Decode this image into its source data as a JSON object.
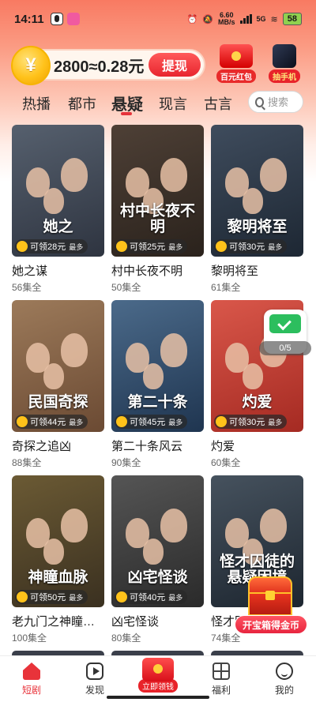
{
  "status_bar": {
    "time": "14:11",
    "net_speed_value": "6.60",
    "net_speed_unit": "MB/s",
    "network": "5G",
    "battery": "58"
  },
  "header": {
    "coin_balance": "2800≈0.28元",
    "coin_symbol": "¥",
    "withdraw_label": "提现",
    "promo_red_packet": "百元红包",
    "promo_phone": "抽手机"
  },
  "tabs": [
    {
      "label": "热播"
    },
    {
      "label": "都市"
    },
    {
      "label": "悬疑",
      "active": true
    },
    {
      "label": "现言"
    },
    {
      "label": "古言"
    }
  ],
  "search": {
    "placeholder": "搜索"
  },
  "dramas": [
    {
      "title": "她之谋",
      "episodes": "56集全",
      "reward": "可领28元",
      "poster_text": "她之",
      "colors": [
        "#2e3440",
        "#56606e"
      ]
    },
    {
      "title": "村中长夜不明",
      "episodes": "50集全",
      "reward": "可领25元",
      "poster_text": "村中长夜不明",
      "colors": [
        "#2a221c",
        "#4e4036"
      ]
    },
    {
      "title": "黎明将至",
      "episodes": "61集全",
      "reward": "可领30元",
      "poster_text": "黎明将至",
      "colors": [
        "#1d2733",
        "#3f4c5d"
      ]
    },
    {
      "title": "奇探之追凶",
      "episodes": "88集全",
      "reward": "可领44元",
      "poster_text": "民国奇探",
      "colors": [
        "#6b4a33",
        "#9c7a5a"
      ]
    },
    {
      "title": "第二十条风云",
      "episodes": "90集全",
      "reward": "可领45元",
      "poster_text": "第二十条",
      "colors": [
        "#1f3550",
        "#4b6a8a"
      ]
    },
    {
      "title": "灼爱",
      "episodes": "60集全",
      "reward": "可领30元",
      "poster_text": "灼爱",
      "colors": [
        "#a52a22",
        "#d9574a"
      ]
    },
    {
      "title": "老九门之神瞳…",
      "episodes": "100集全",
      "reward": "可领50元",
      "poster_text": "神瞳血脉",
      "colors": [
        "#3a3020",
        "#6b5a34"
      ]
    },
    {
      "title": "凶宅怪谈",
      "episodes": "80集全",
      "reward": "可领40元",
      "poster_text": "凶宅怪谈",
      "colors": [
        "#2a2a2a",
        "#555555"
      ]
    },
    {
      "title": "怪才囚徒",
      "episodes": "74集全",
      "reward": "",
      "poster_text": "怪才囚徒的悬疑困境",
      "colors": [
        "#1d2630",
        "#46525e"
      ]
    }
  ],
  "reward_suffix": "最多",
  "float_widget": {
    "progress": "0/5"
  },
  "treasure": {
    "label": "开宝箱得金币"
  },
  "bottom_nav": {
    "items": [
      {
        "label": "短剧",
        "active": true
      },
      {
        "label": "发现"
      },
      {
        "label": "立即领钱"
      },
      {
        "label": "福利"
      },
      {
        "label": "我的"
      }
    ]
  },
  "colors": {
    "accent": "#e8333a",
    "gold": "#ffc21a"
  }
}
